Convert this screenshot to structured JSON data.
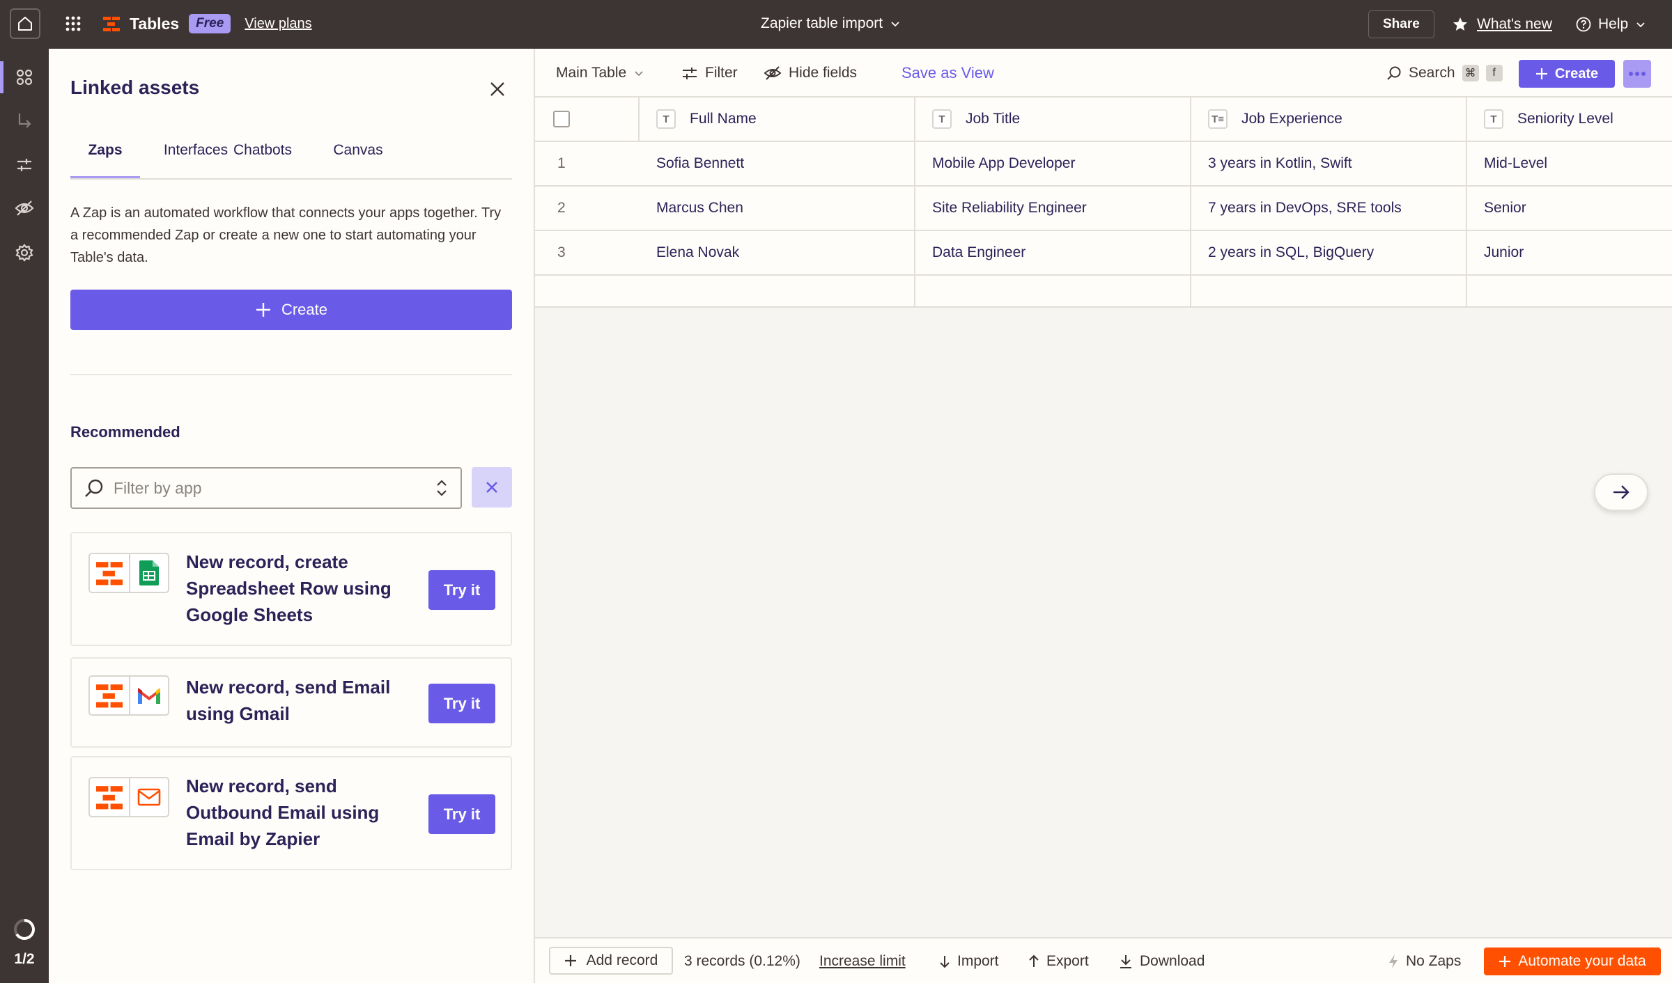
{
  "topbar": {
    "brand_name": "Tables",
    "plan_badge": "Free",
    "view_plans": "View plans",
    "doc_title": "Zapier table import",
    "share": "Share",
    "whats_new": "What's new",
    "help": "Help"
  },
  "rail": {
    "icons": [
      "apps-icon",
      "arrow-return-icon",
      "sliders-icon",
      "eye-off-icon",
      "gear-icon"
    ],
    "page_indicator": "1/2"
  },
  "panel": {
    "title": "Linked assets",
    "tabs": [
      {
        "label": "Zaps",
        "active": true
      },
      {
        "label": "Interfaces",
        "active": false
      },
      {
        "label": "Chatbots",
        "active": false
      },
      {
        "label": "Canvas",
        "active": false
      }
    ],
    "description": "A Zap is an automated workflow that connects your apps together. Try a recommended Zap or create a new one to start automating your Table's data.",
    "create": "Create",
    "recommended": "Recommended",
    "filter_placeholder": "Filter by app",
    "zaps": [
      {
        "text": "New record, create Spreadsheet Row using Google Sheets",
        "action": "Try it",
        "app_icon": "google-sheets-icon"
      },
      {
        "text": "New record, send Email using Gmail",
        "action": "Try it",
        "app_icon": "gmail-icon"
      },
      {
        "text": "New record, send Outbound Email using Email by Zapier",
        "action": "Try it",
        "app_icon": "email-by-zapier-icon"
      }
    ]
  },
  "toolbar": {
    "view_name": "Main Table",
    "filter": "Filter",
    "hide_fields": "Hide fields",
    "save_as_view": "Save as View",
    "search": "Search",
    "shortcut_cmd": "⌘",
    "shortcut_key": "f",
    "create": "Create"
  },
  "table": {
    "columns": [
      {
        "label": "Full Name",
        "type_icon": "T"
      },
      {
        "label": "Job Title",
        "type_icon": "T"
      },
      {
        "label": "Job Experience",
        "type_icon": "T≡"
      },
      {
        "label": "Seniority Level",
        "type_icon": "T"
      }
    ],
    "rows": [
      {
        "num": "1",
        "cells": [
          "Sofia Bennett",
          "Mobile App Developer",
          "3 years in Kotlin, Swift",
          "Mid-Level"
        ]
      },
      {
        "num": "2",
        "cells": [
          "Marcus Chen",
          "Site Reliability Engineer",
          "7 years in DevOps, SRE tools",
          "Senior"
        ]
      },
      {
        "num": "3",
        "cells": [
          "Elena Novak",
          "Data Engineer",
          "2 years in SQL, BigQuery",
          "Junior"
        ]
      }
    ]
  },
  "footer": {
    "add_record": "Add record",
    "records_count": "3 records (0.12%)",
    "increase_limit": "Increase limit",
    "import": "Import",
    "export": "Export",
    "download": "Download",
    "no_zaps": "No Zaps",
    "automate": "Automate your data"
  },
  "colors": {
    "accent": "#695be8",
    "accent_light": "#a99af3",
    "topbar": "#3d3434",
    "zapier_orange": "#ff4f00"
  }
}
